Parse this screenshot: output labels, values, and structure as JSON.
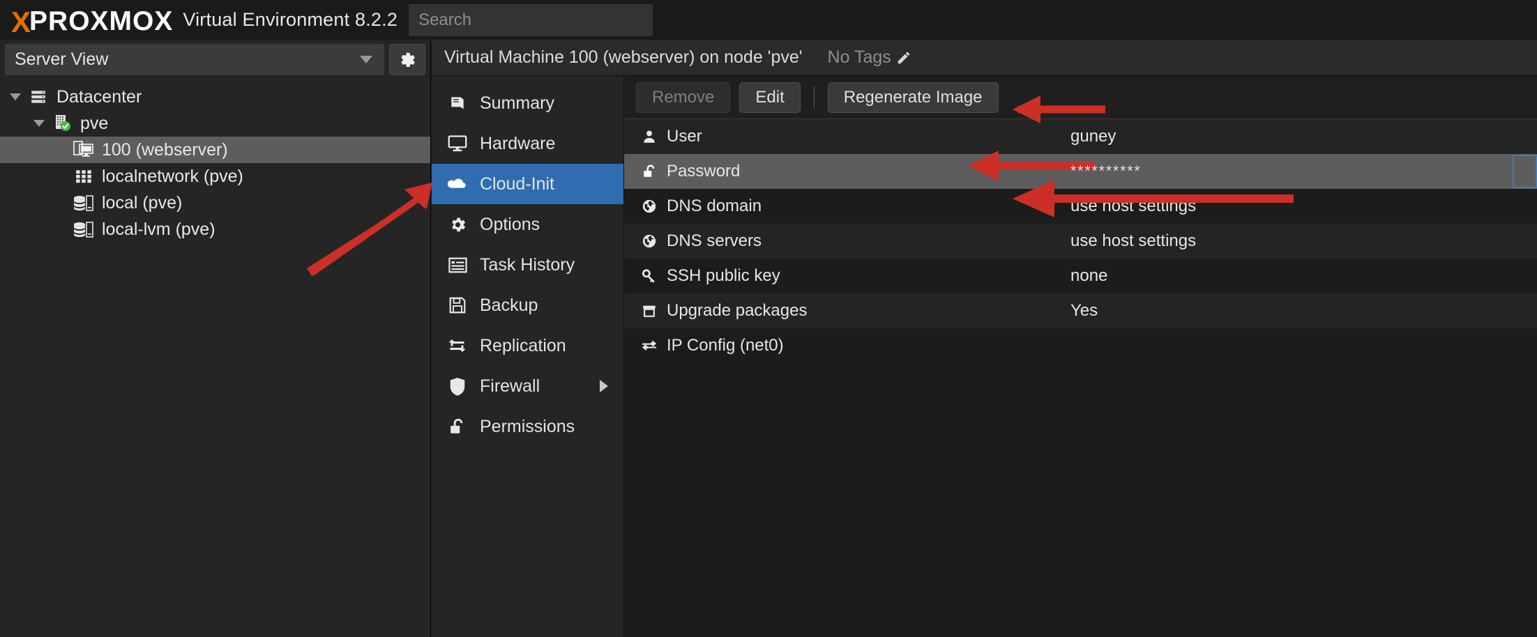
{
  "app": {
    "logo_x": "X",
    "logo_pro": "PRO",
    "logo_x2": "X",
    "logo_mo": "MO",
    "logo_x3": "X",
    "product_name": "Virtual Environment 8.2.2",
    "accent_color": "#e57000",
    "highlight_color": "#2f6cb0",
    "selection_color": "#5d5d5d",
    "annotation_color": "#cc2f26"
  },
  "search": {
    "placeholder": "Search",
    "value": ""
  },
  "sidebar": {
    "view_selector": {
      "label": "Server View"
    },
    "gear_button": {
      "icon": "gear-icon"
    },
    "tree": [
      {
        "label": "Datacenter",
        "icon": "datacenter-icon",
        "level": 0,
        "expanded": true,
        "selected": false
      },
      {
        "label": "pve",
        "icon": "node-icon",
        "level": 1,
        "expanded": true,
        "selected": false
      },
      {
        "label": "100 (webserver)",
        "icon": "vm-icon",
        "level": 2,
        "expanded": false,
        "selected": true
      },
      {
        "label": "localnetwork (pve)",
        "icon": "network-icon",
        "level": 2,
        "expanded": false,
        "selected": false
      },
      {
        "label": "local (pve)",
        "icon": "storage-icon",
        "level": 2,
        "expanded": false,
        "selected": false
      },
      {
        "label": "local-lvm (pve)",
        "icon": "storage-icon",
        "level": 2,
        "expanded": false,
        "selected": false
      }
    ]
  },
  "header": {
    "title": "Virtual Machine 100 (webserver) on node 'pve'",
    "tags_label": "No Tags",
    "tags_edit_icon": "pencil-icon"
  },
  "nav": {
    "items": [
      {
        "label": "Summary",
        "icon": "book-icon",
        "active": false,
        "has_submenu": false
      },
      {
        "label": "Hardware",
        "icon": "monitor-icon",
        "active": false,
        "has_submenu": false
      },
      {
        "label": "Cloud-Init",
        "icon": "cloud-icon",
        "active": true,
        "has_submenu": false
      },
      {
        "label": "Options",
        "icon": "gear-icon",
        "active": false,
        "has_submenu": false
      },
      {
        "label": "Task History",
        "icon": "list-icon",
        "active": false,
        "has_submenu": false
      },
      {
        "label": "Backup",
        "icon": "floppy-disk-icon",
        "active": false,
        "has_submenu": false
      },
      {
        "label": "Replication",
        "icon": "replication-icon",
        "active": false,
        "has_submenu": false
      },
      {
        "label": "Firewall",
        "icon": "shield-icon",
        "active": false,
        "has_submenu": true
      },
      {
        "label": "Permissions",
        "icon": "unlock-icon",
        "active": false,
        "has_submenu": false
      }
    ]
  },
  "toolbar": {
    "remove_label": "Remove",
    "remove_disabled": true,
    "edit_label": "Edit",
    "regenerate_label": "Regenerate Image"
  },
  "cloudinit": {
    "rows": [
      {
        "key": "User",
        "value": "guney",
        "icon": "user-icon",
        "selected": false
      },
      {
        "key": "Password",
        "value": "**********",
        "icon": "unlock-icon",
        "selected": true
      },
      {
        "key": "DNS domain",
        "value": "use host settings",
        "icon": "globe-icon",
        "selected": false
      },
      {
        "key": "DNS servers",
        "value": "use host settings",
        "icon": "globe-icon",
        "selected": false
      },
      {
        "key": "SSH public key",
        "value": "none",
        "icon": "key-icon",
        "selected": false
      },
      {
        "key": "Upgrade packages",
        "value": "Yes",
        "icon": "box-icon",
        "selected": false
      },
      {
        "key": "IP Config (net0)",
        "value": "",
        "icon": "exchange-icon",
        "selected": false
      }
    ]
  },
  "annotations": [
    {
      "name": "arrow-to-cloud-init",
      "target": "Cloud-Init menu item"
    },
    {
      "name": "arrow-to-regenerate-image",
      "target": "Regenerate Image button"
    },
    {
      "name": "arrow-to-user-value",
      "target": "User value guney"
    },
    {
      "name": "arrow-to-password-value",
      "target": "Password value"
    }
  ]
}
